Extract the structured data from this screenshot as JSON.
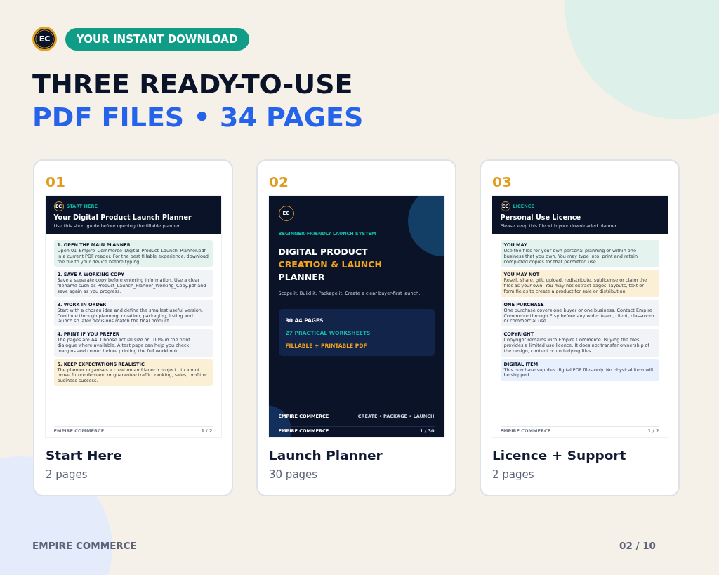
{
  "brand": {
    "logo": "EC",
    "badge": "YOUR INSTANT DOWNLOAD"
  },
  "headline": {
    "line_1": "THREE READY-TO-USE",
    "line_2": "PDF FILES • 34 PAGES"
  },
  "files": [
    {
      "number": "01",
      "title": "Start Here",
      "pages": "2 pages",
      "preview": {
        "kind": "guide",
        "logo": "EC",
        "eyebrow": "START HERE",
        "title": "Your Digital Product Launch Planner",
        "subtitle": "Use this short guide before opening the fillable planner.",
        "sections": [
          {
            "heading": "1. OPEN THE MAIN PLANNER",
            "text": "Open 01_Empire_Commerce_Digital_Product_Launch_Planner.pdf in a current PDF reader. For the best fillable experience, download the file to your device before typing.",
            "color": "#e4f3ee"
          },
          {
            "heading": "2. SAVE A WORKING COPY",
            "text": "Save a separate copy before entering information. Use a clear filename such as Product_Launch_Planner_Working_Copy.pdf and save again as you progress.",
            "color": "#f1f3f6"
          },
          {
            "heading": "3. WORK IN ORDER",
            "text": "Start with a chosen idea and define the smallest useful version. Continue through planning, creation, packaging, listing and launch so later decisions match the final product.",
            "color": "#f1f3f6"
          },
          {
            "heading": "4. PRINT IF YOU PREFER",
            "text": "The pages are A4. Choose actual size or 100% in the print dialogue where available. A test page can help you check margins and colour before printing the full workbook.",
            "color": "#f1f3f6"
          },
          {
            "heading": "5. KEEP EXPECTATIONS REALISTIC",
            "text": "The planner organises a creation and launch project. It cannot prove future demand or guarantee traffic, ranking, sales, profit or business success.",
            "color": "#fbf0d6"
          }
        ],
        "footer_left": "EMPIRE COMMERCE",
        "footer_right": "1 / 2"
      }
    },
    {
      "number": "02",
      "title": "Launch Planner",
      "pages": "30 pages",
      "preview": {
        "kind": "cover",
        "logo": "EC",
        "eyebrow": "BEGINNER-FRIENDLY LAUNCH SYSTEM",
        "title_lines": [
          {
            "text": "DIGITAL PRODUCT",
            "color": "#ffffff"
          },
          {
            "text": "CREATION & LAUNCH",
            "color": "#f2a51c"
          },
          {
            "text": "PLANNER",
            "color": "#ffffff"
          }
        ],
        "tagline": "Scope it. Build it. Package it. Create a clear buyer-first launch.",
        "highlights": [
          {
            "text": "30 A4 PAGES",
            "color": "#ffffff"
          },
          {
            "text": "27 PRACTICAL WORKSHEETS",
            "color": "#14b8a6"
          },
          {
            "text": "FILLABLE + PRINTABLE PDF",
            "color": "#f2a51c"
          }
        ],
        "band_left": "EMPIRE COMMERCE",
        "band_right": "CREATE • PACKAGE • LAUNCH",
        "footer_left": "EMPIRE COMMERCE",
        "footer_right": "1 / 30"
      }
    },
    {
      "number": "03",
      "title": "Licence + Support",
      "pages": "2 pages",
      "preview": {
        "kind": "guide",
        "logo": "EC",
        "eyebrow": "LICENCE",
        "title": "Personal Use Licence",
        "subtitle": "Please keep this file with your downloaded planner.",
        "sections": [
          {
            "heading": "YOU MAY",
            "text": "Use the files for your own personal planning or within one business that you own. You may type into, print and retain completed copies for that permitted use.",
            "color": "#e4f3ee"
          },
          {
            "heading": "YOU MAY NOT",
            "text": "Resell, share, gift, upload, redistribute, sublicense or claim the files as your own. You may not extract pages, layouts, text or form fields to create a product for sale or distribution.",
            "color": "#fbf0d6"
          },
          {
            "heading": "ONE PURCHASE",
            "text": "One purchase covers one buyer or one business. Contact Empire Commerce through Etsy before any wider team, client, classroom or commercial use.",
            "color": "#f1f3f6"
          },
          {
            "heading": "COPYRIGHT",
            "text": "Copyright remains with Empire Commerce. Buying the files provides a limited use licence. It does not transfer ownership of the design, content or underlying files.",
            "color": "#f1f3f6"
          },
          {
            "heading": "DIGITAL ITEM",
            "text": "This purchase supplies digital PDF files only. No physical item will be shipped.",
            "color": "#e8effd"
          }
        ],
        "footer_left": "EMPIRE COMMERCE",
        "footer_right": "1 / 2"
      }
    }
  ],
  "footer": {
    "brand": "EMPIRE COMMERCE",
    "page": "02 / 10"
  }
}
